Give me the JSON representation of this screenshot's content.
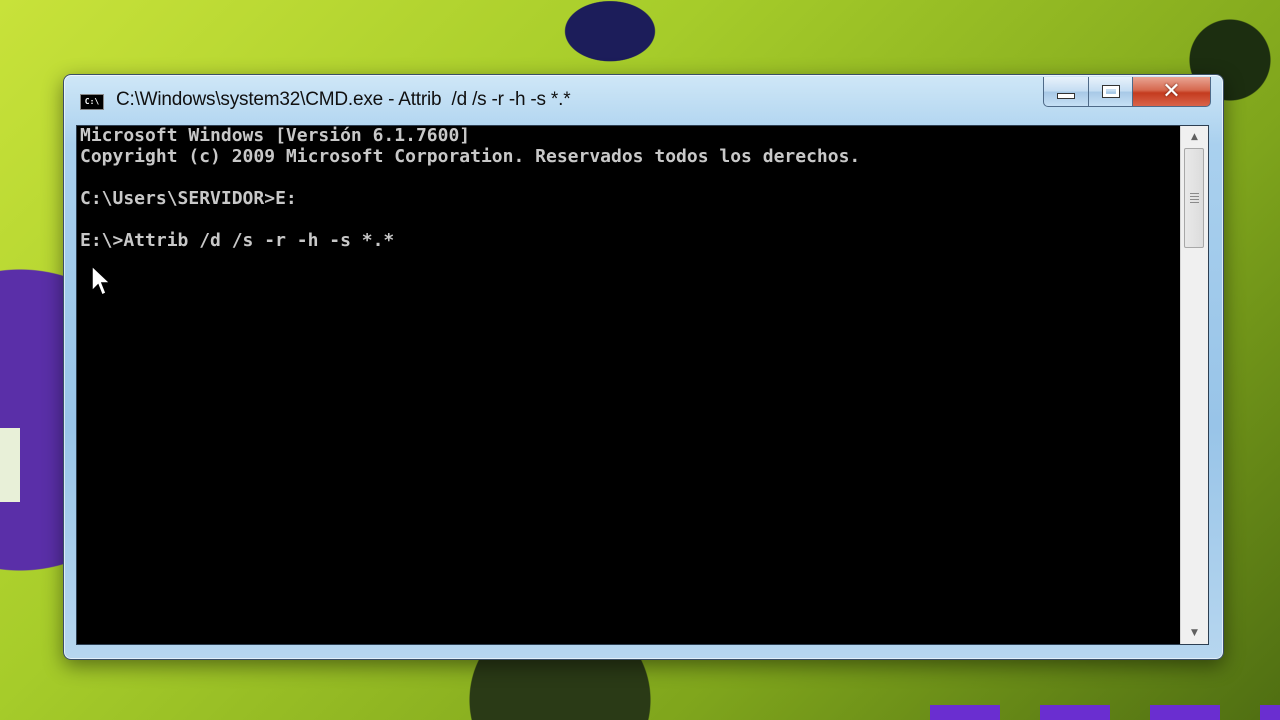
{
  "window": {
    "title": "C:\\Windows\\system32\\CMD.exe - Attrib  /d /s -r -h -s *.*",
    "icon_label": "C:\\",
    "controls": {
      "minimize": "minimize",
      "maximize": "maximize",
      "close": "✕"
    }
  },
  "console": {
    "lines": [
      "Microsoft Windows [Versión 6.1.7600]",
      "Copyright (c) 2009 Microsoft Corporation. Reservados todos los derechos.",
      "",
      "C:\\Users\\SERVIDOR>E:",
      "",
      "E:\\>Attrib /d /s -r -h -s *.*"
    ],
    "text_color": "#c8c8c8",
    "background_color": "#000000"
  },
  "scrollbar": {
    "up_glyph": "▲",
    "down_glyph": "▼"
  }
}
